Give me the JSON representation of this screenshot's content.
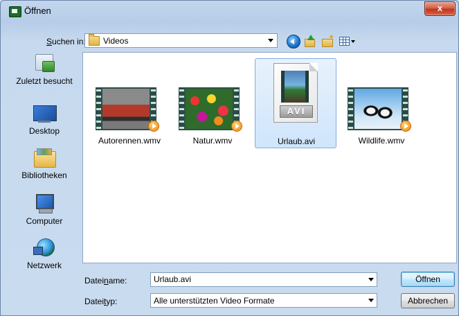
{
  "window": {
    "title": "Öffnen",
    "close_label": "x"
  },
  "toolbar": {
    "lookin_label_prefix": "",
    "lookin_label_access": "S",
    "lookin_label_rest": "uchen in:",
    "location": "Videos"
  },
  "places": [
    {
      "label": "Zuletzt besucht",
      "icon": "recent-places-icon"
    },
    {
      "label": "Desktop",
      "icon": "desktop-icon"
    },
    {
      "label": "Bibliotheken",
      "icon": "libraries-icon"
    },
    {
      "label": "Computer",
      "icon": "computer-icon"
    },
    {
      "label": "Netzwerk",
      "icon": "network-icon"
    }
  ],
  "files": [
    {
      "name": "Autorennen.wmv",
      "type": "video-thumbnail"
    },
    {
      "name": "Natur.wmv",
      "type": "video-thumbnail"
    },
    {
      "name": "Urlaub.avi",
      "type": "avi-file-icon",
      "badge": "AVI",
      "selected": true
    },
    {
      "name": "Wildlife.wmv",
      "type": "video-thumbnail"
    }
  ],
  "bottom": {
    "filename_label_a": "Datei",
    "filename_label_access": "n",
    "filename_label_b": "ame:",
    "filename_value": "Urlaub.avi",
    "filetype_label_a": "Datei",
    "filetype_label_access": "t",
    "filetype_label_b": "yp:",
    "filetype_value": "Alle unterstützten Video Formate",
    "open_label": "Öffnen",
    "cancel_label": "Abbrechen"
  }
}
